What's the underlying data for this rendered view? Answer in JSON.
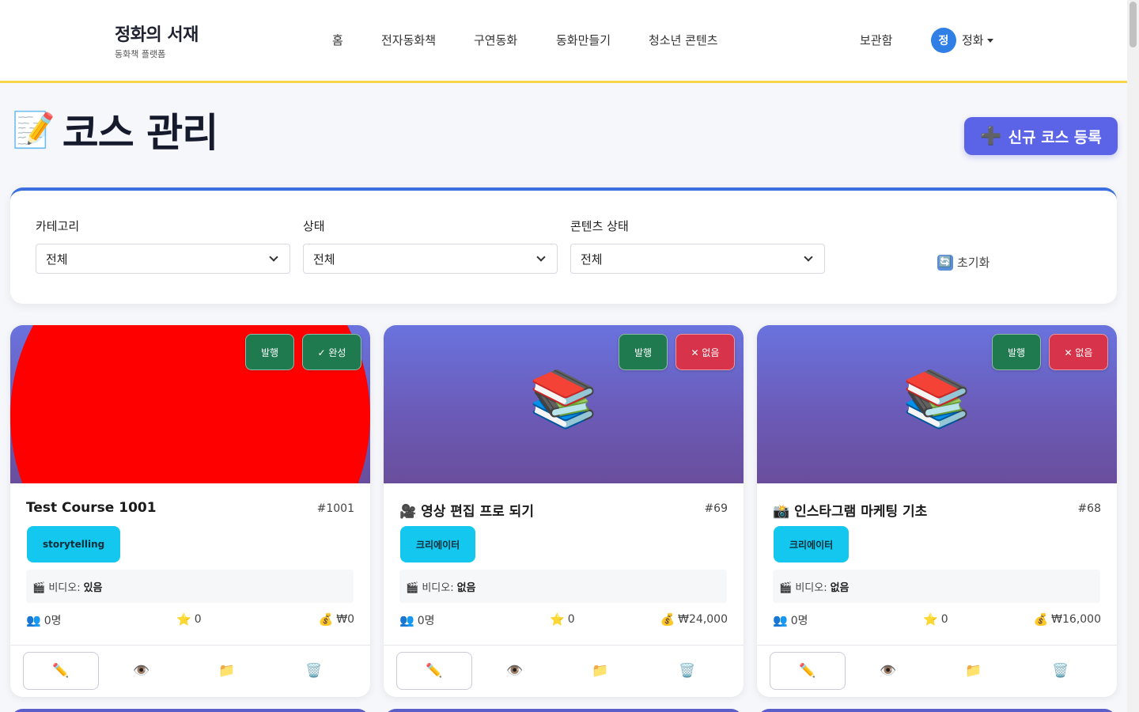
{
  "header": {
    "brand_title": "정화의 서재",
    "brand_sub": "동화책 플랫폼",
    "nav": [
      "홈",
      "전자동화책",
      "구연동화",
      "동화만들기",
      "청소년 콘텐츠"
    ],
    "library": "보관함",
    "avatar_initial": "정",
    "user_name": "정화"
  },
  "page": {
    "title_icon": "📝",
    "title": "코스 관리",
    "new_button": "신규 코스 등록",
    "new_button_icon": "➕"
  },
  "filters": {
    "category_label": "카테고리",
    "category_value": "전체",
    "status_label": "상태",
    "status_value": "전체",
    "content_label": "콘텐츠 상태",
    "content_value": "전체",
    "reset_label": "초기화",
    "reset_icon": "🔄"
  },
  "cards": [
    {
      "badge_pub": "발행",
      "badge_status": "✓ 완성",
      "status_color": "#1f7a4f",
      "hero": "red-circle",
      "title": "Test Course 1001",
      "id": "#1001",
      "category": "storytelling",
      "video_label": "🎬 비디오:",
      "video_value": "있음",
      "students": "0명",
      "rating": "0",
      "price": "₩0",
      "student_icon": "👥",
      "rating_icon": "⭐",
      "price_icon": "💰"
    },
    {
      "badge_pub": "발행",
      "badge_status": "✕ 없음",
      "status_color": "#d7334a",
      "hero": "📚",
      "title": "🎥 영상 편집 프로 되기",
      "id": "#69",
      "category": "크리에이터",
      "video_label": "🎬 비디오:",
      "video_value": "없음",
      "students": "0명",
      "rating": "0",
      "price": "₩24,000",
      "student_icon": "👥",
      "rating_icon": "⭐",
      "price_icon": "💰"
    },
    {
      "badge_pub": "발행",
      "badge_status": "✕ 없음",
      "status_color": "#d7334a",
      "hero": "📚",
      "title": "📸 인스타그램 마케팅 기초",
      "id": "#68",
      "category": "크리에이터",
      "video_label": "🎬 비디오:",
      "video_value": "없음",
      "students": "0명",
      "rating": "0",
      "price": "₩16,000",
      "student_icon": "👥",
      "rating_icon": "⭐",
      "price_icon": "💰"
    }
  ],
  "card_actions": [
    "✏️",
    "👁️",
    "📁",
    "🗑️"
  ],
  "colors": {
    "accent": "#5b63e6",
    "header_border": "#f6d648",
    "filter_top": "#3b6fe0",
    "tag": "#14c7ee"
  }
}
